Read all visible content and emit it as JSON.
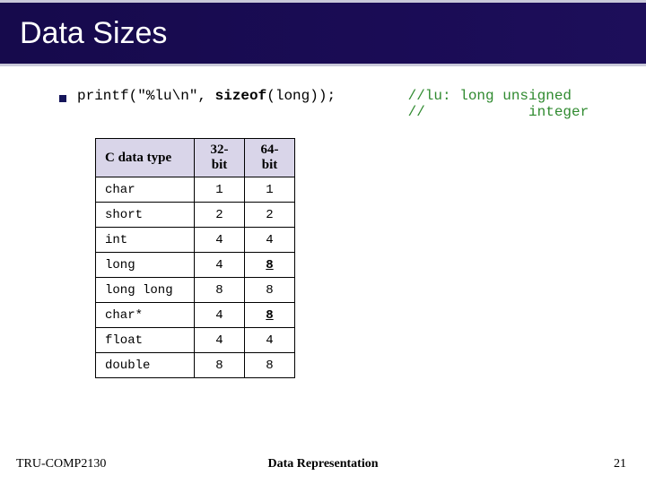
{
  "title": "Data Sizes",
  "code": {
    "line1": "printf(\"%lu\\n\", ",
    "kw": "sizeof",
    "after_kw": "(long));",
    "comment_l1": " //lu: long unsigned",
    "comment_l2": " //            integer"
  },
  "table": {
    "headers": [
      "C data type",
      "32-bit",
      "64-bit"
    ],
    "rows": [
      {
        "type": "char",
        "b32": "1",
        "b64": "1",
        "hi": false
      },
      {
        "type": "short",
        "b32": "2",
        "b64": "2",
        "hi": false
      },
      {
        "type": "int",
        "b32": "4",
        "b64": "4",
        "hi": false
      },
      {
        "type": "long",
        "b32": "4",
        "b64": "8",
        "hi": true
      },
      {
        "type": "long long",
        "b32": "8",
        "b64": "8",
        "hi": false
      },
      {
        "type": "char*",
        "b32": "4",
        "b64": "8",
        "hi": true
      },
      {
        "type": "float",
        "b32": "4",
        "b64": "4",
        "hi": false
      },
      {
        "type": "double",
        "b32": "8",
        "b64": "8",
        "hi": false
      }
    ]
  },
  "footer": {
    "left": "TRU-COMP2130",
    "center": "Data Representation",
    "right": "21"
  },
  "chart_data": {
    "type": "table",
    "title": "Data Sizes",
    "columns": [
      "C data type",
      "32-bit",
      "64-bit"
    ],
    "rows": [
      [
        "char",
        1,
        1
      ],
      [
        "short",
        2,
        2
      ],
      [
        "int",
        4,
        4
      ],
      [
        "long",
        4,
        8
      ],
      [
        "long long",
        8,
        8
      ],
      [
        "char*",
        4,
        8
      ],
      [
        "float",
        4,
        4
      ],
      [
        "double",
        8,
        8
      ]
    ]
  }
}
